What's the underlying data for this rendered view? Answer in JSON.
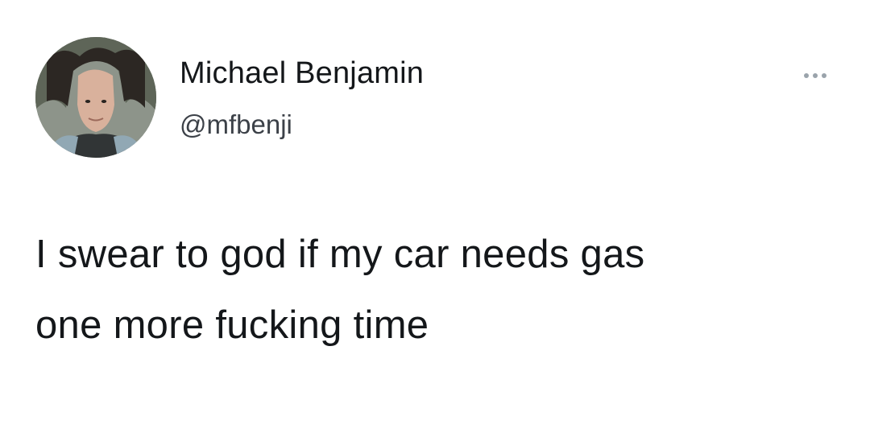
{
  "author": {
    "name": "Michael Benjamin",
    "handle": "@mfbenji"
  },
  "tweet": {
    "lines": [
      "I swear to god if my car needs gas",
      "one more fucking time"
    ]
  },
  "icons": {
    "more": "more-horizontal-icon",
    "avatar": "profile-photo"
  }
}
